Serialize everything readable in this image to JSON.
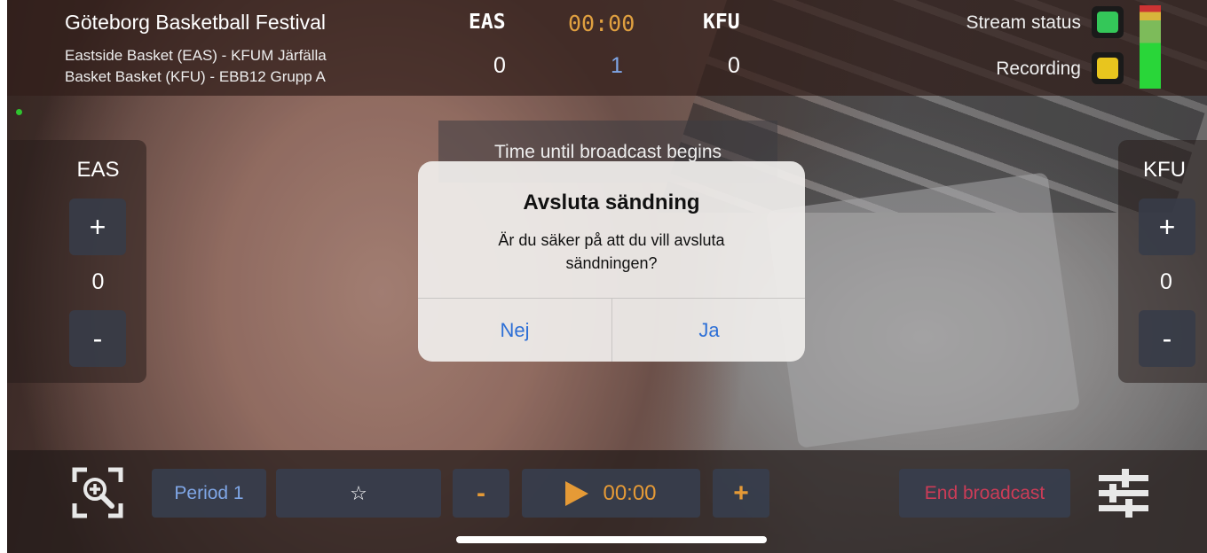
{
  "header": {
    "event_title": "Göteborg Basketball Festival",
    "match_line_1": "Eastside Basket (EAS) - KFUM Järfälla",
    "match_line_2": "Basket Basket (KFU) - EBB12 Grupp A"
  },
  "scoreboard": {
    "home_abbr": "EAS",
    "away_abbr": "KFU",
    "clock": "00:00",
    "home_score": "0",
    "period": "1",
    "away_score": "0"
  },
  "status": {
    "stream_label": "Stream status",
    "stream_color": "#34c759",
    "recording_label": "Recording",
    "recording_color": "#e8c51e"
  },
  "home_panel": {
    "abbr": "EAS",
    "plus": "+",
    "score": "0",
    "minus": "-"
  },
  "away_panel": {
    "abbr": "KFU",
    "plus": "+",
    "score": "0",
    "minus": "-"
  },
  "countdown": {
    "label": "Time until broadcast begins"
  },
  "alert": {
    "title": "Avsluta sändning",
    "message": "Är du säker på att du vill avsluta sändningen?",
    "no_label": "Nej",
    "yes_label": "Ja"
  },
  "toolbar": {
    "period_label": "Period 1",
    "star_label": "☆",
    "clock_minus": "-",
    "clock_time": "00:00",
    "clock_plus": "+",
    "end_label": "End broadcast"
  },
  "icons": {
    "zoom": "zoom-icon",
    "settings": "sliders-icon",
    "play": "play-icon"
  }
}
